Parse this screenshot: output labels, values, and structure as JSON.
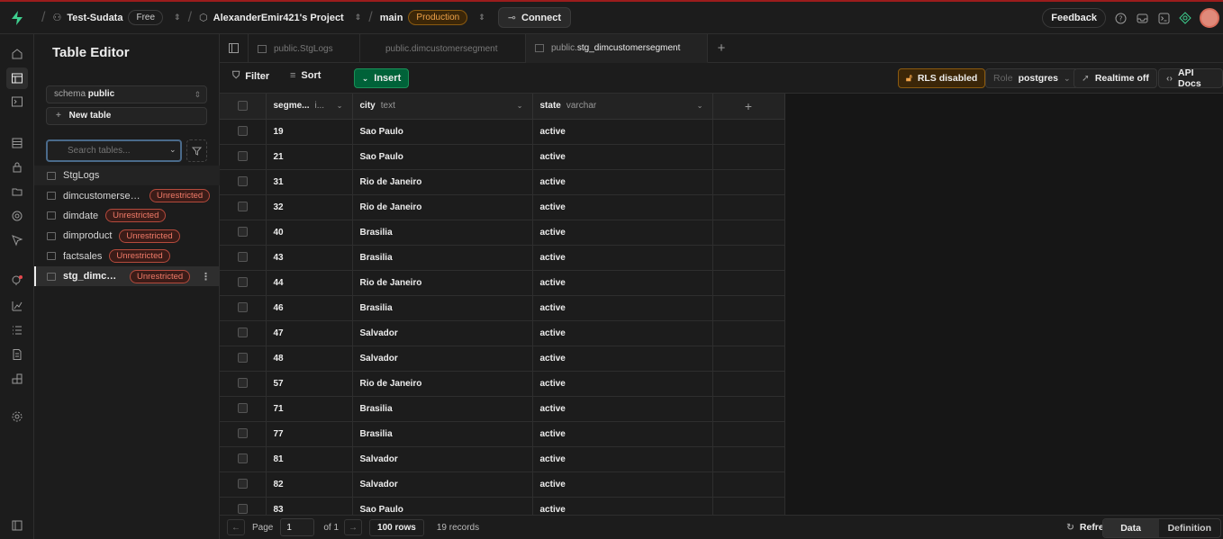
{
  "topbar": {
    "org": "Test-Sudata",
    "plan": "Free",
    "project": "AlexanderEmir421's Project",
    "branch": "main",
    "env": "Production",
    "connect": "Connect",
    "feedback": "Feedback"
  },
  "sidebar": {
    "title": "Table Editor",
    "schema_label": "schema",
    "schema_value": "public",
    "new_table": "New table",
    "search_placeholder": "Search tables...",
    "tables": [
      {
        "name": "StgLogs",
        "badge": ""
      },
      {
        "name": "dimcustomersegment",
        "badge": "Unrestricted"
      },
      {
        "name": "dimdate",
        "badge": "Unrestricted"
      },
      {
        "name": "dimproduct",
        "badge": "Unrestricted"
      },
      {
        "name": "factsales",
        "badge": "Unrestricted"
      },
      {
        "name": "stg_dimcustomersegment",
        "badge": "Unrestricted"
      }
    ]
  },
  "tabs": [
    {
      "schema": "public.",
      "name": "StgLogs"
    },
    {
      "schema": "public.",
      "name": "dimcustomersegment"
    },
    {
      "schema": "public.",
      "name": "stg_dimcustomersegment"
    }
  ],
  "toolbar": {
    "filter": "Filter",
    "sort": "Sort",
    "insert": "Insert",
    "rls": "RLS disabled",
    "role_label": "Role",
    "role_value": "postgres",
    "realtime": "Realtime off",
    "api_docs": "API Docs"
  },
  "grid": {
    "columns": [
      {
        "name": "segme...",
        "type": "i..."
      },
      {
        "name": "city",
        "type": "text"
      },
      {
        "name": "state",
        "type": "varchar"
      }
    ],
    "rows": [
      [
        "19",
        "Sao Paulo",
        "active"
      ],
      [
        "21",
        "Sao Paulo",
        "active"
      ],
      [
        "31",
        "Rio de Janeiro",
        "active"
      ],
      [
        "32",
        "Rio de Janeiro",
        "active"
      ],
      [
        "40",
        "Brasilia",
        "active"
      ],
      [
        "43",
        "Brasilia",
        "active"
      ],
      [
        "44",
        "Rio de Janeiro",
        "active"
      ],
      [
        "46",
        "Brasilia",
        "active"
      ],
      [
        "47",
        "Salvador",
        "active"
      ],
      [
        "48",
        "Salvador",
        "active"
      ],
      [
        "57",
        "Rio de Janeiro",
        "active"
      ],
      [
        "71",
        "Brasilia",
        "active"
      ],
      [
        "77",
        "Brasilia",
        "active"
      ],
      [
        "81",
        "Salvador",
        "active"
      ],
      [
        "82",
        "Salvador",
        "active"
      ],
      [
        "83",
        "Sao Paulo",
        "active"
      ]
    ]
  },
  "footer": {
    "page_label": "Page",
    "page_value": "1",
    "of_label": "of 1",
    "rows": "100 rows",
    "records": "19 records",
    "refresh": "Refresh",
    "data": "Data",
    "definition": "Definition"
  }
}
